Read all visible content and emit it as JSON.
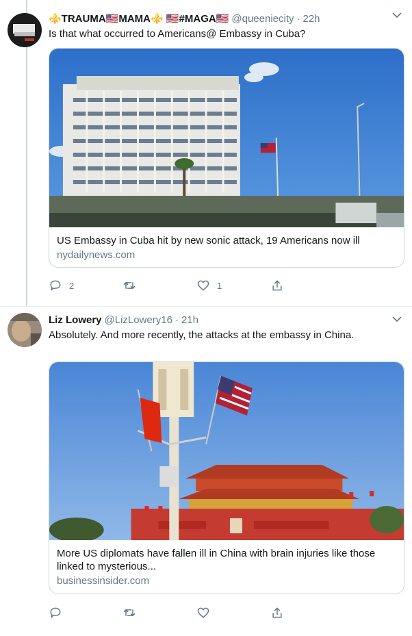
{
  "tweets": [
    {
      "display_name": "⚜️TRAUMA🇺🇸MAMA⚜️ 🇺🇸#MAGA🇺🇸",
      "handle": "@queeniecity",
      "time": "22h",
      "text": "Is that what occurred to Americans@ Embassy in Cuba?",
      "card": {
        "title": "US Embassy in Cuba hit by new sonic attack, 19 Americans now ill",
        "domain": "nydailynews.com"
      },
      "actions": {
        "replies": "2",
        "retweets": "",
        "likes": "1"
      }
    },
    {
      "display_name": "Liz Lowery",
      "handle": "@LizLowery16",
      "time": "21h",
      "text": "Absolutely.  And more recently,  the attacks at the embassy in China.",
      "card": {
        "title": "More US diplomats have fallen ill in China with brain injuries like those linked to mysterious...",
        "domain": "businessinsider.com"
      },
      "actions": {
        "replies": "",
        "retweets": "",
        "likes": ""
      }
    }
  ],
  "icons": [
    "reply-icon",
    "retweet-icon",
    "like-icon",
    "share-icon",
    "chevron-down-icon"
  ],
  "colors": {
    "text": "#14171a",
    "secondary": "#657786",
    "border": "#ccd6dd"
  }
}
